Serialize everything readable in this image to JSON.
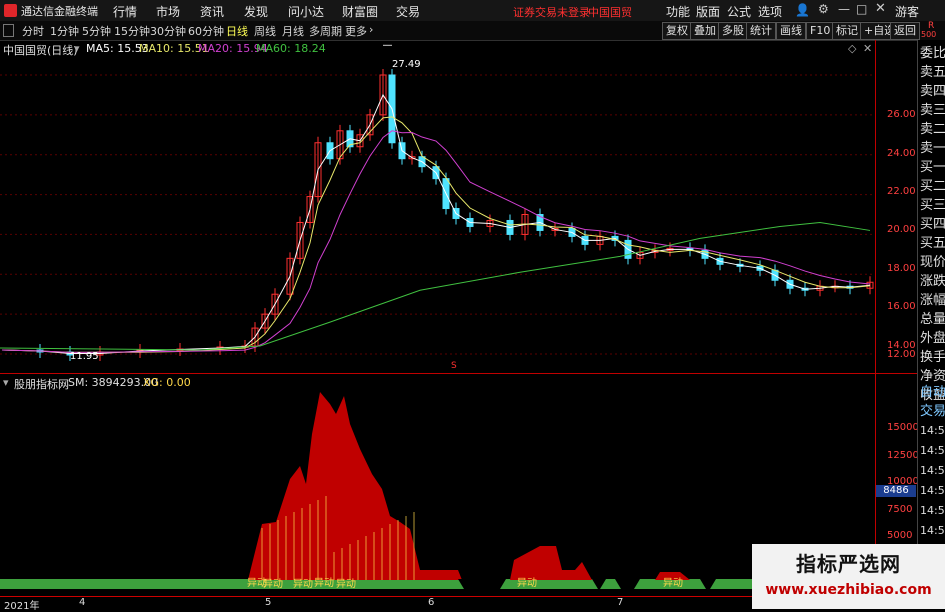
{
  "app": {
    "title": "通达信金融终端"
  },
  "menu": {
    "items": [
      "行情",
      "市场",
      "资讯",
      "发现",
      "问小达",
      "财富圈",
      "交易"
    ],
    "status": "证券交易未登录",
    "stock": "中国国贸",
    "right_items": [
      "功能",
      "版面",
      "公式",
      "选项"
    ],
    "guest": "游客"
  },
  "toolbar": {
    "periods": [
      "分时",
      "1分钟",
      "5分钟",
      "15分钟",
      "30分钟",
      "60分钟",
      "日线",
      "周线",
      "月线",
      "多周期",
      "更多"
    ],
    "active_period": "日线",
    "buttons": [
      "复权",
      "叠加",
      "多股",
      "统计",
      "画线",
      "F10",
      "标记",
      "+自选",
      "返回"
    ]
  },
  "main_chart": {
    "stock_label": "中国国贸(日线)",
    "ma5": "MA5: 15.53",
    "ma10": "MA10: 15.51",
    "ma20": "MA20: 15.94",
    "ma60": "MA60: 18.24",
    "high_label": "27.49",
    "low_label": "11.95",
    "marker": "S",
    "colors": {
      "ma5": "#ffffff",
      "ma10": "#e8e86a",
      "ma20": "#d040d0",
      "ma60": "#40c040",
      "up": "#ff3030",
      "down": "#4fe3ff"
    }
  },
  "price_axis": [
    "26.00",
    "24.00",
    "22.00",
    "20.00",
    "18.00",
    "16.00",
    "14.00",
    "12.00"
  ],
  "indicator": {
    "name": "股朋指标网",
    "sm": "SM: 3894293.00",
    "xg": "XG: 0.00",
    "axis": [
      "15000",
      "12500",
      "10000",
      "7500",
      "5000",
      "2500"
    ],
    "highlight": "8486",
    "signals": [
      "异动",
      "异动",
      "异动",
      "异动",
      "异动",
      "异动",
      "异动"
    ]
  },
  "side_panel": {
    "labels": [
      "委比",
      "卖五",
      "卖四",
      "卖三",
      "卖二",
      "卖一",
      "买一",
      "买二",
      "买三",
      "买四",
      "买五",
      "现价",
      "涨跌",
      "涨幅",
      "总量",
      "外盘",
      "换手",
      "净资",
      "收益"
    ],
    "auto": "自动",
    "trade": "交易",
    "times": [
      "14:56",
      "14:56",
      "14:56",
      "14:56",
      "14:56",
      "14:56",
      "14:56",
      "14:56",
      "14:56"
    ],
    "top": "R",
    "top_num": "500"
  },
  "date_axis": [
    "2021年",
    "4",
    "5",
    "6",
    "7"
  ],
  "watermark": {
    "title": "指标严选网",
    "url": "www.xuezhibiao.com"
  }
}
